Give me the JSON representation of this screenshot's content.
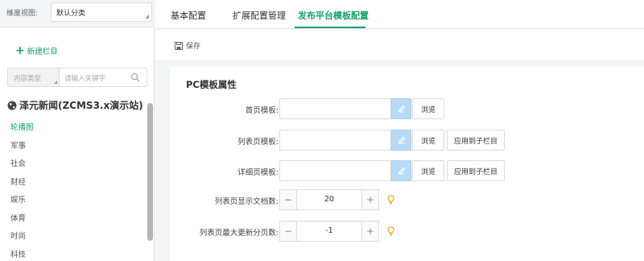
{
  "sidebar": {
    "dimension_label": "维度视图:",
    "dimension_value": "默认分类",
    "new_column": "新建栏目",
    "content_type_placeholder": "内容类型",
    "keyword_placeholder": "请输入关键字",
    "site_title": "泽元新闻(ZCMS3.x演示站)",
    "items": [
      {
        "label": "轮播图"
      },
      {
        "label": "军事"
      },
      {
        "label": "社会"
      },
      {
        "label": "财经"
      },
      {
        "label": "娱乐"
      },
      {
        "label": "体育"
      },
      {
        "label": "时尚"
      },
      {
        "label": "科技"
      }
    ]
  },
  "tabs": [
    {
      "label": "基本配置"
    },
    {
      "label": "扩展配置管理"
    },
    {
      "label": "发布平台模板配置"
    }
  ],
  "toolbar": {
    "save_label": "保存"
  },
  "panel": {
    "title": "PC模板属性",
    "rows": {
      "index": {
        "label": "首页模板:",
        "value": "",
        "browse": "浏览"
      },
      "list": {
        "label": "列表页模板:",
        "value": "",
        "browse": "浏览",
        "apply": "应用到子栏目"
      },
      "detail": {
        "label": "详细页模板:",
        "value": "",
        "browse": "浏览",
        "apply": "应用到子栏目"
      },
      "list_count": {
        "label": "列表页显示文档数:",
        "value": "20"
      },
      "list_pages": {
        "label": "列表页最大更新分页数:",
        "value": "-1"
      }
    }
  },
  "colors": {
    "accent": "#1aa068",
    "pen_button": "#b8dbf5",
    "bulb": "#f5a623"
  }
}
